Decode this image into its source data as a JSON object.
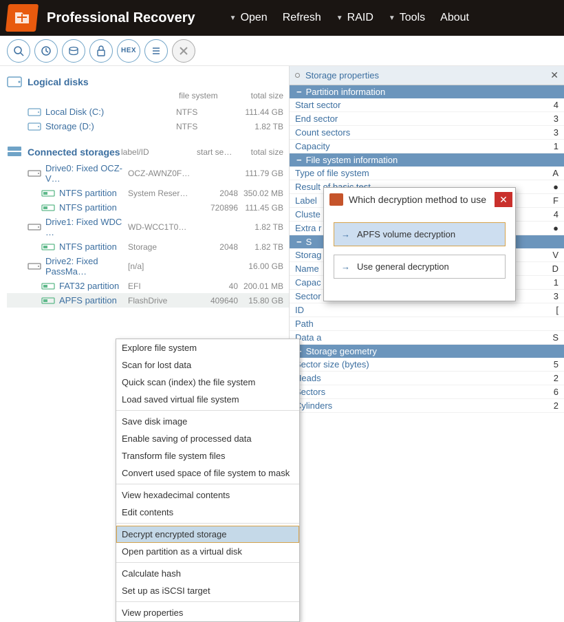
{
  "app": {
    "title": "Professional Recovery"
  },
  "menu": {
    "open": "Open",
    "refresh": "Refresh",
    "raid": "RAID",
    "tools": "Tools",
    "about": "About"
  },
  "toolbar": {
    "hex_label": "HEX"
  },
  "left": {
    "logical_heading": "Logical disks",
    "col_fs": "file system",
    "col_total": "total size",
    "logical": [
      {
        "name": "Local Disk (C:)",
        "fs": "NTFS",
        "size": "111.44 GB"
      },
      {
        "name": "Storage (D:)",
        "fs": "NTFS",
        "size": "1.82 TB"
      }
    ],
    "connected_heading": "Connected storages",
    "col_label": "label/ID",
    "col_start": "start se…",
    "drives": [
      {
        "name": "Drive0: Fixed OCZ-V…",
        "label": "OCZ-AWNZ0F…",
        "start": "",
        "size": "111.79 GB",
        "parts": [
          {
            "name": "NTFS partition",
            "label": "System Reser…",
            "start": "2048",
            "size": "350.02 MB"
          },
          {
            "name": "NTFS partition",
            "label": "",
            "start": "720896",
            "size": "111.45 GB"
          }
        ]
      },
      {
        "name": "Drive1: Fixed WDC …",
        "label": "WD-WCC1T0…",
        "start": "",
        "size": "1.82 TB",
        "parts": [
          {
            "name": "NTFS partition",
            "label": "Storage",
            "start": "2048",
            "size": "1.82 TB"
          }
        ]
      },
      {
        "name": "Drive2: Fixed PassMa…",
        "label": "[n/a]",
        "start": "",
        "size": "16.00 GB",
        "parts": [
          {
            "name": "FAT32 partition",
            "label": "EFI",
            "start": "40",
            "size": "200.01 MB"
          },
          {
            "name": "APFS partition",
            "label": "FlashDrive",
            "start": "409640",
            "size": "15.80 GB",
            "selected": true
          }
        ]
      }
    ]
  },
  "context_menu": {
    "items": [
      "Explore file system",
      "Scan for lost data",
      "Quick scan (index) the file system",
      "Load saved virtual file system",
      "-",
      "Save disk image",
      "Enable saving of processed data",
      "Transform file system files",
      "Convert used space of file system to mask",
      "-",
      "View hexadecimal contents",
      "Edit contents",
      "-",
      "Decrypt encrypted storage",
      "Open partition as a virtual disk",
      "-",
      "Calculate hash",
      "Set up as iSCSI target",
      "-",
      "View properties"
    ],
    "highlighted_index": 13
  },
  "right": {
    "tab_title": "Storage properties",
    "groups": [
      {
        "title": "Partition information",
        "rows": [
          {
            "k": "Start sector",
            "v": "4"
          },
          {
            "k": "End sector",
            "v": "3"
          },
          {
            "k": "Count sectors",
            "v": "3"
          },
          {
            "k": "Capacity",
            "v": "1"
          }
        ]
      },
      {
        "title": "File system information",
        "rows": [
          {
            "k": "Type of file system",
            "v": "A"
          },
          {
            "k": "Result of basic test",
            "v": "●"
          },
          {
            "k": "Label",
            "v": "F"
          },
          {
            "k": "Cluste",
            "v": "4"
          },
          {
            "k": "Extra r",
            "v": "●"
          }
        ]
      },
      {
        "title": "S",
        "rows": [
          {
            "k": "Storag",
            "v": "V"
          },
          {
            "k": "Name",
            "v": "D"
          },
          {
            "k": "Capac",
            "v": "1"
          },
          {
            "k": "Sector",
            "v": "3"
          },
          {
            "k": "ID",
            "v": "["
          },
          {
            "k": "Path",
            "v": ""
          },
          {
            "k": "Data a",
            "v": "S"
          }
        ]
      },
      {
        "title": "Storage geometry",
        "rows": [
          {
            "k": "Sector size (bytes)",
            "v": "5"
          },
          {
            "k": "Heads",
            "v": "2"
          },
          {
            "k": "Sectors",
            "v": "6"
          },
          {
            "k": "Cylinders",
            "v": "2"
          }
        ]
      }
    ]
  },
  "dialog": {
    "title": "Which decryption method to use",
    "opt1": "APFS volume decryption",
    "opt2": "Use general decryption"
  }
}
